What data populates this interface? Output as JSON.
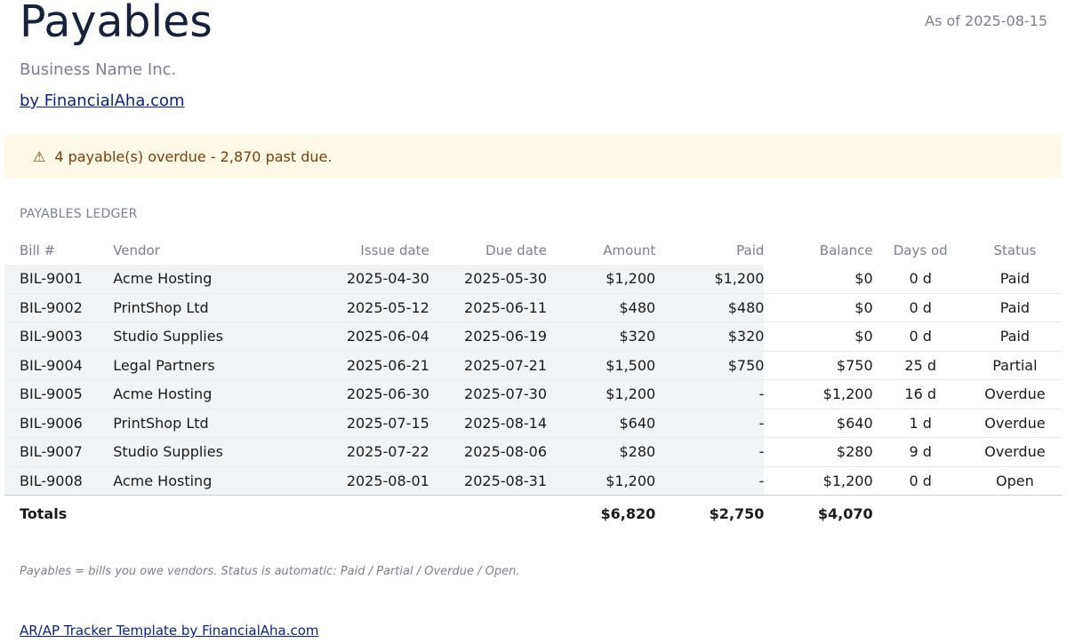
{
  "header": {
    "title": "Payables",
    "as_of": "As of 2025-08-15",
    "business_name": "Business Name Inc.",
    "by_link": "by FinancialAha.com"
  },
  "alert": {
    "icon": "warning-icon",
    "icon_glyph": "⚠",
    "text": "4 payable(s) overdue - 2,870 past due."
  },
  "ledger": {
    "section_label": "PAYABLES LEDGER",
    "columns": [
      "Bill #",
      "Vendor",
      "Issue date",
      "Due date",
      "Amount",
      "Paid",
      "Balance",
      "Days od",
      "Status"
    ],
    "rows": [
      {
        "bill": "BIL-9001",
        "vendor": "Acme Hosting",
        "issue": "2025-04-30",
        "due": "2025-05-30",
        "amount": "$1,200",
        "paid": "$1,200",
        "balance": "$0",
        "days": "0 d",
        "status": "Paid"
      },
      {
        "bill": "BIL-9002",
        "vendor": "PrintShop Ltd",
        "issue": "2025-05-12",
        "due": "2025-06-11",
        "amount": "$480",
        "paid": "$480",
        "balance": "$0",
        "days": "0 d",
        "status": "Paid"
      },
      {
        "bill": "BIL-9003",
        "vendor": "Studio Supplies",
        "issue": "2025-06-04",
        "due": "2025-06-19",
        "amount": "$320",
        "paid": "$320",
        "balance": "$0",
        "days": "0 d",
        "status": "Paid"
      },
      {
        "bill": "BIL-9004",
        "vendor": "Legal Partners",
        "issue": "2025-06-21",
        "due": "2025-07-21",
        "amount": "$1,500",
        "paid": "$750",
        "balance": "$750",
        "days": "25 d",
        "status": "Partial"
      },
      {
        "bill": "BIL-9005",
        "vendor": "Acme Hosting",
        "issue": "2025-06-30",
        "due": "2025-07-30",
        "amount": "$1,200",
        "paid": "-",
        "balance": "$1,200",
        "days": "16 d",
        "status": "Overdue"
      },
      {
        "bill": "BIL-9006",
        "vendor": "PrintShop Ltd",
        "issue": "2025-07-15",
        "due": "2025-08-14",
        "amount": "$640",
        "paid": "-",
        "balance": "$640",
        "days": "1 d",
        "status": "Overdue"
      },
      {
        "bill": "BIL-9007",
        "vendor": "Studio Supplies",
        "issue": "2025-07-22",
        "due": "2025-08-06",
        "amount": "$280",
        "paid": "-",
        "balance": "$280",
        "days": "9 d",
        "status": "Overdue"
      },
      {
        "bill": "BIL-9008",
        "vendor": "Acme Hosting",
        "issue": "2025-08-01",
        "due": "2025-08-31",
        "amount": "$1,200",
        "paid": "-",
        "balance": "$1,200",
        "days": "0 d",
        "status": "Open"
      }
    ],
    "totals": {
      "label": "Totals",
      "amount": "$6,820",
      "paid": "$2,750",
      "balance": "$4,070"
    }
  },
  "footnote": "Payables = bills you owe vendors. Status is automatic: Paid / Partial / Overdue / Open.",
  "bottom_link": "AR/AP Tracker Template by FinancialAha.com"
}
